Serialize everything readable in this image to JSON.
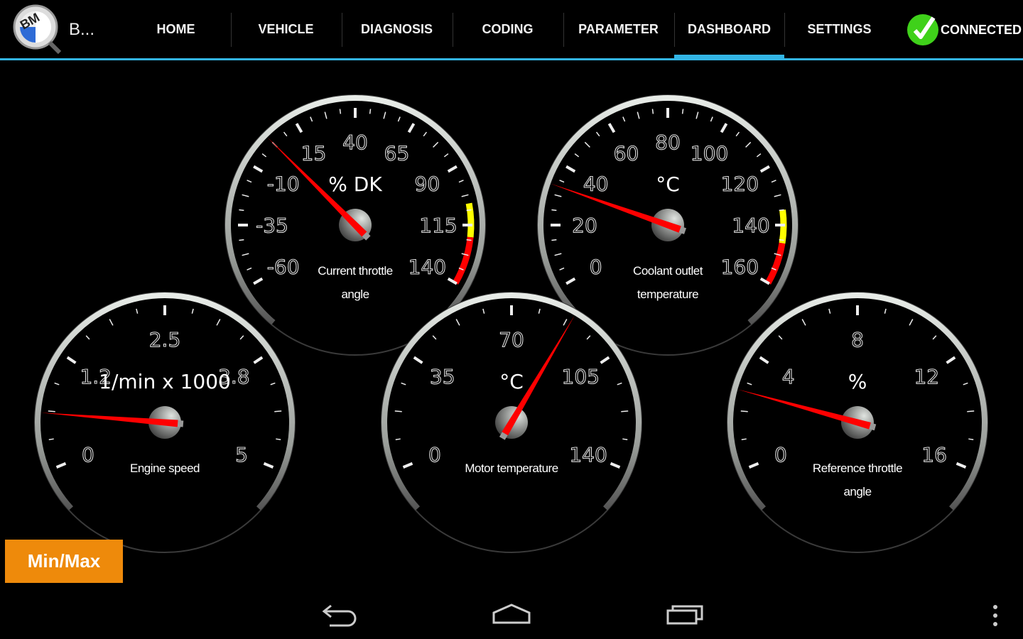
{
  "header": {
    "app_title": "B...",
    "tabs": [
      {
        "label": "HOME",
        "active": false
      },
      {
        "label": "VEHICLE",
        "active": false
      },
      {
        "label": "DIAGNOSIS",
        "active": false
      },
      {
        "label": "CODING",
        "active": false
      },
      {
        "label": "PARAMETER",
        "active": false
      },
      {
        "label": "DASHBOARD",
        "active": true
      },
      {
        "label": "SETTINGS",
        "active": false
      }
    ],
    "status": "CONNECTED",
    "accent": "#33b5e5"
  },
  "gauges": [
    {
      "title_lines": [
        "Current throttle",
        "angle"
      ],
      "unit": "% DK",
      "labels": [
        "-60",
        "-35",
        "-10",
        "15",
        "40",
        "65",
        "90",
        "115",
        "140"
      ],
      "min": -60,
      "max": 140,
      "value": 2.5,
      "zones": [
        {
          "from": 106,
          "to": 120,
          "color": "#ffff00"
        },
        {
          "from": 120,
          "to": 140,
          "color": "#ff0000"
        }
      ]
    },
    {
      "title_lines": [
        "Coolant outlet",
        "temperature"
      ],
      "unit": "°C",
      "labels": [
        "0",
        "20",
        "40",
        "60",
        "80",
        "100",
        "120",
        "140",
        "160"
      ],
      "min": 0,
      "max": 160,
      "value": 33,
      "zones": [
        {
          "from": 135,
          "to": 146,
          "color": "#ffff00"
        },
        {
          "from": 146,
          "to": 160,
          "color": "#ff0000"
        }
      ]
    },
    {
      "title_lines": [
        "Engine speed"
      ],
      "unit": "1/min x 1000",
      "labels": [
        "0",
        "1.2",
        "2.5",
        "3.8",
        "5"
      ],
      "min": 0,
      "max": 5,
      "value": 0.6,
      "zones": []
    },
    {
      "title_lines": [
        "Motor temperature"
      ],
      "unit": "°C",
      "labels": [
        "0",
        "35",
        "70",
        "105",
        "140"
      ],
      "min": 0,
      "max": 140,
      "value": 89,
      "zones": []
    },
    {
      "title_lines": [
        "Reference throttle",
        "angle"
      ],
      "unit": "%",
      "labels": [
        "0",
        "4",
        "8",
        "12",
        "16"
      ],
      "min": 0,
      "max": 16,
      "value": 2.7,
      "zones": []
    }
  ],
  "buttons": {
    "minmax": "Min/Max"
  },
  "colors": {
    "needle": "#ff0000",
    "minmax_bg": "#ee8a0b",
    "connected": "#3fd11a"
  }
}
